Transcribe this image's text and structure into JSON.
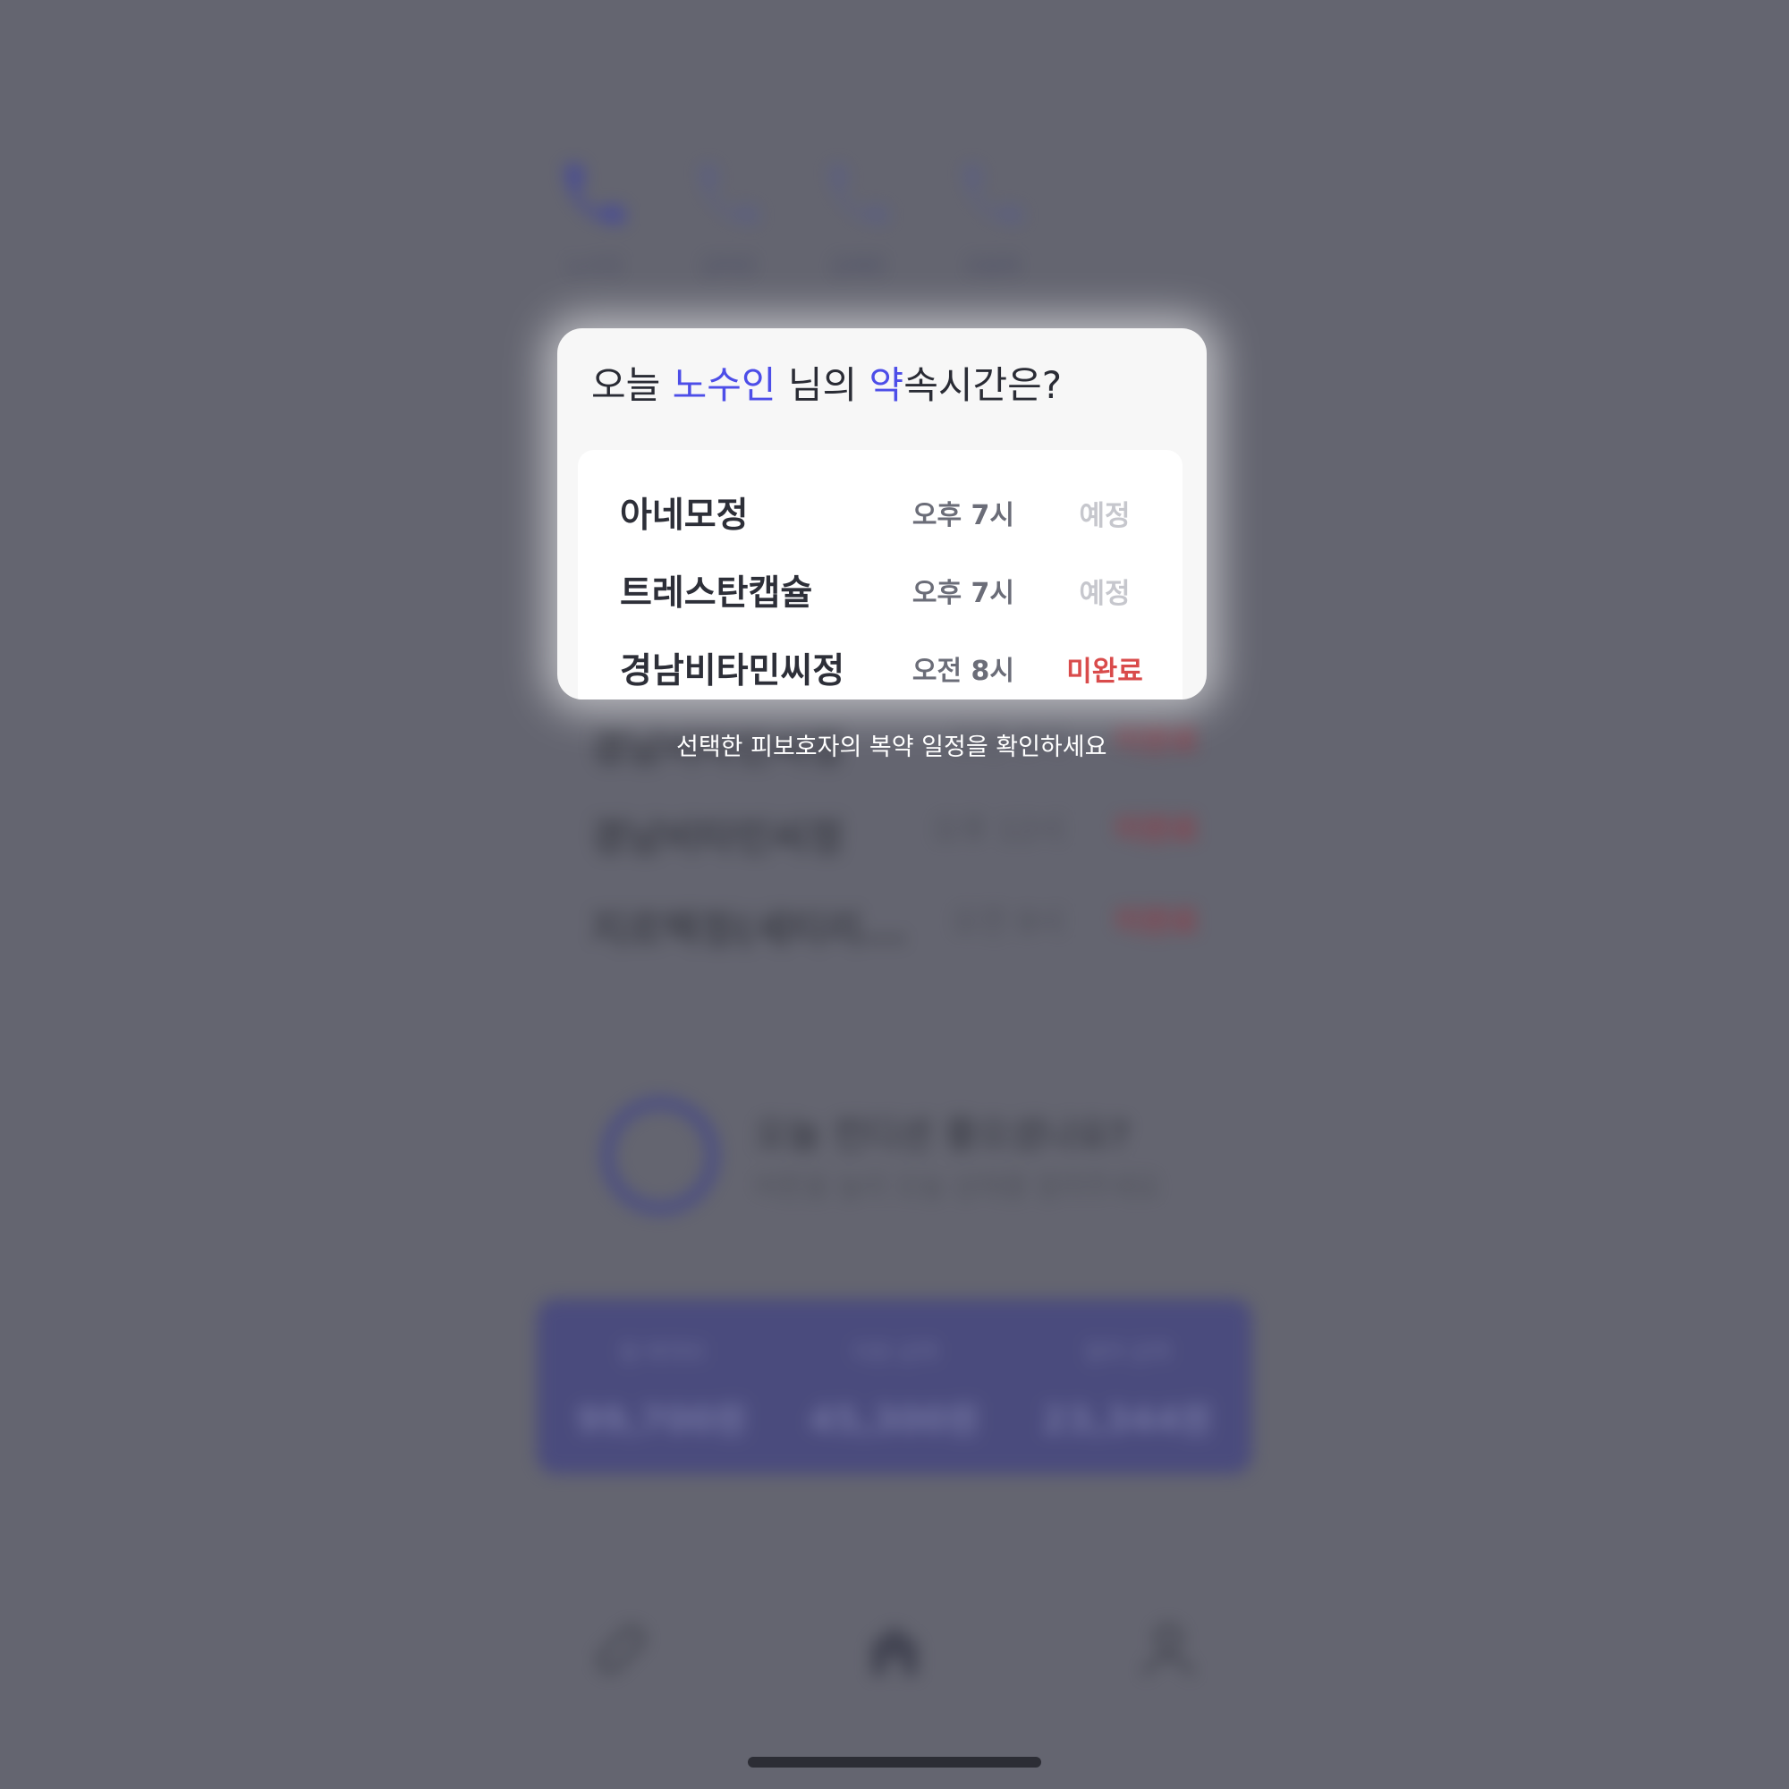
{
  "background": {
    "call_shortcuts": [
      {
        "label": "노수인",
        "active": true
      },
      {
        "label": "김하은",
        "active": false
      },
      {
        "label": "김재민",
        "active": false
      },
      {
        "label": "조윤희",
        "active": false
      }
    ],
    "medication_list": [
      {
        "name": "경남비타민씨정",
        "time": "오전 8시",
        "status": "미완료"
      },
      {
        "name": "경남비타민씨정",
        "time": "오후 12시",
        "status": "미완료"
      },
      {
        "name": "지르텍정(세티리...",
        "time": "오전 8시",
        "status": "미완료"
      }
    ],
    "condition_prompt": {
      "title": "오늘 컨디션 좋으셨나요?",
      "subtitle": "버튼을 눌러 오늘 상태를 알려주세요"
    },
    "summary_panel": [
      {
        "label": "월 복약비",
        "value": "99,700원"
      },
      {
        "label": "지원 금액",
        "value": "45,300원"
      },
      {
        "label": "절약 금액",
        "value": "23,344원"
      }
    ],
    "bottom_nav": [
      "pill-icon",
      "home-icon",
      "profile-icon"
    ]
  },
  "modal": {
    "title": {
      "prefix": "오늘 ",
      "patient_name": "노수인",
      "middle": " 님의 ",
      "highlight_char": "약",
      "suffix": "속시간은?"
    },
    "accent_color": "#4d4ee8",
    "schedule": [
      {
        "name": "아네모정",
        "time": "오후 7시",
        "status": "예정"
      },
      {
        "name": "트레스탄캡슐",
        "time": "오후 7시",
        "status": "예정"
      },
      {
        "name": "경남비타민씨정",
        "time": "오전 8시",
        "status": "미완료"
      }
    ],
    "status_colors": {
      "planned": "#c6c7cd",
      "incomplete": "#d94b4b"
    }
  },
  "tooltip": {
    "caption": "선택한 피보호자의 복약 일정을 확인하세요"
  }
}
